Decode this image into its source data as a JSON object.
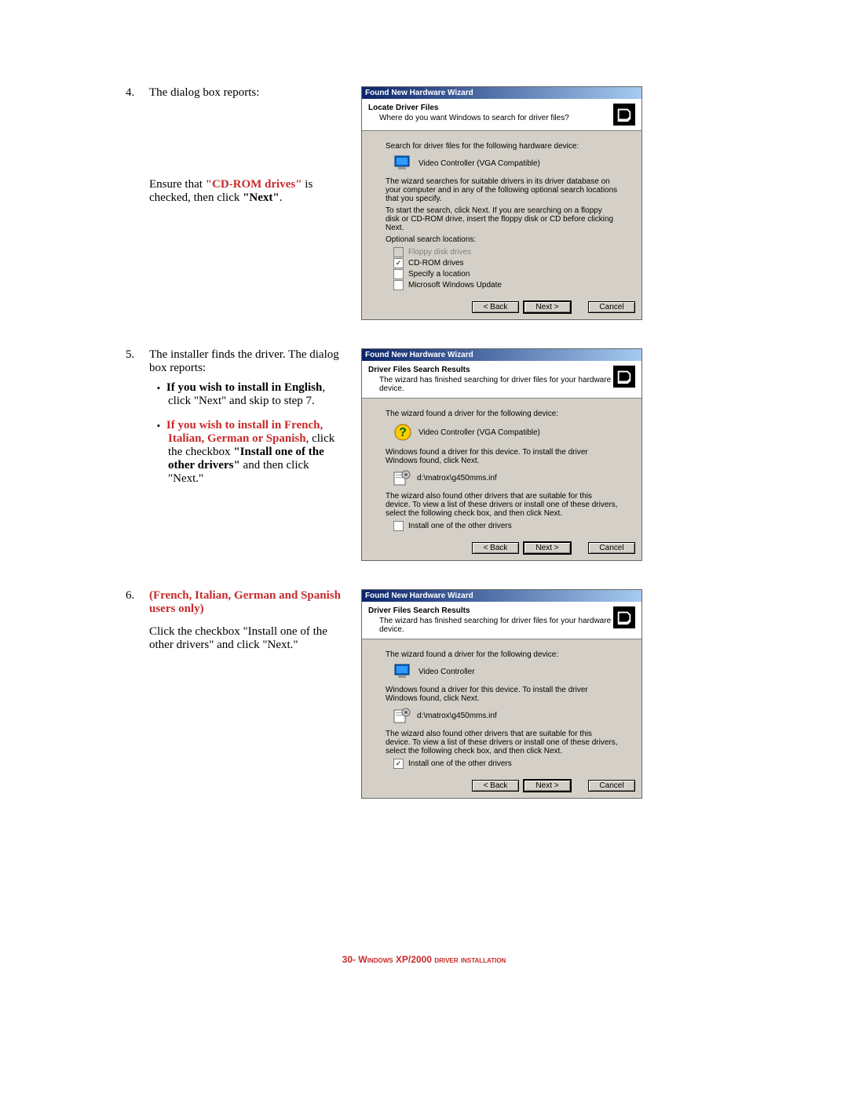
{
  "step4": {
    "num": "4.",
    "line1": "The dialog box reports:",
    "p2a": "Ensure that ",
    "p2b": "\"CD-ROM drives\"",
    "p2c": " is checked, then click ",
    "p2d": "\"Next\"",
    "p2e": "."
  },
  "step5": {
    "num": "5.",
    "line1": "The installer finds the driver. The dialog box reports:",
    "b1a": "If you wish to install in English",
    "b1b": ", click \"Next\" and skip to step 7.",
    "b2a": "If you wish to install in French, Italian, German or Spanish",
    "b2b": ", click the checkbox ",
    "b2c": "\"Install one of the other drivers\"",
    "b2d": " and then click \"Next.\""
  },
  "step6": {
    "num": "6.",
    "title": "(French, Italian, German and Spanish users only)",
    "body": "Click the checkbox \"Install one of the other drivers\" and click \"Next.\""
  },
  "d1": {
    "title": "Found New Hardware Wizard",
    "htitle": "Locate Driver Files",
    "hsub": "Where do you want Windows to search for driver files?",
    "l1": "Search for driver files for the following hardware device:",
    "device": "Video Controller (VGA Compatible)",
    "l2": "The wizard searches for suitable drivers in its driver database on your computer and in any of the following optional search locations that you specify.",
    "l3": "To start the search, click Next. If you are searching on a floppy disk or CD-ROM drive, insert the floppy disk or CD before clicking Next.",
    "l4": "Optional search locations:",
    "o1": "Floppy disk drives",
    "o2": "CD-ROM drives",
    "o3": "Specify a location",
    "o4": "Microsoft Windows Update",
    "back": "< Back",
    "next": "Next >",
    "cancel": "Cancel"
  },
  "d2": {
    "title": "Found New Hardware Wizard",
    "htitle": "Driver Files Search Results",
    "hsub": "The wizard has finished searching for driver files for your hardware device.",
    "l1": "The wizard found a driver for the following device:",
    "device": "Video Controller (VGA Compatible)",
    "l2": "Windows found a driver for this device. To install the driver Windows found, click Next.",
    "path": "d:\\matrox\\g450mms.inf",
    "l3": "The wizard also found other drivers that are suitable for this device. To view a list of these drivers or install one of these drivers, select the following check box, and then click Next.",
    "o1": "Install one of the other drivers",
    "back": "< Back",
    "next": "Next >",
    "cancel": "Cancel"
  },
  "d3": {
    "title": "Found New Hardware Wizard",
    "htitle": "Driver Files Search Results",
    "hsub": "The wizard has finished searching for driver files for your hardware device.",
    "l1": "The wizard found a driver for the following device:",
    "device": "Video Controller",
    "l2": "Windows found a driver for this device. To install the driver Windows found, click Next.",
    "path": "d:\\matrox\\g450mms.inf",
    "l3": "The wizard also found other drivers that are suitable for this device. To view a list of these drivers or install one of these drivers, select the following check box, and then click Next.",
    "o1": "Install one of the other drivers",
    "back": "< Back",
    "next": "Next >",
    "cancel": "Cancel"
  },
  "footer": {
    "pnum": "30",
    "dash": "- ",
    "title": "Windows XP/2000 driver installation"
  }
}
